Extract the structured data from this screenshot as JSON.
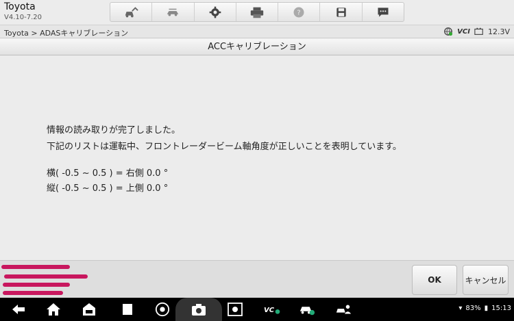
{
  "header": {
    "app_title": "Toyota",
    "version": "V4.10-7.20",
    "toolbar_icons": [
      "vehicle-home-icon",
      "vehicle-swap-icon",
      "gear-icon",
      "printer-icon",
      "help-icon",
      "save-icon",
      "chat-icon"
    ]
  },
  "breadcrumb": "Toyota > ADASキャリブレーション",
  "status": {
    "vci": "VCI",
    "voltage": "12.3V"
  },
  "page_title": "ACCキャリブレーション",
  "messages": {
    "line1": "情報の読み取りが完了しました。",
    "line2": "下記のリストは運転中、フロントレーダービーム軸角度が正しいことを表明しています。",
    "line3": "横( -0.5 ~ 0.5 ) = 右側 0.0 °",
    "line4": "縦( -0.5 ~ 0.5 ) = 上側 0.0 °"
  },
  "buttons": {
    "ok": "OK",
    "cancel": "キャンセル"
  },
  "system": {
    "battery": "83%",
    "time": "15:13"
  },
  "colors": {
    "redaction": "#c8175e",
    "navbar": "#000000"
  }
}
